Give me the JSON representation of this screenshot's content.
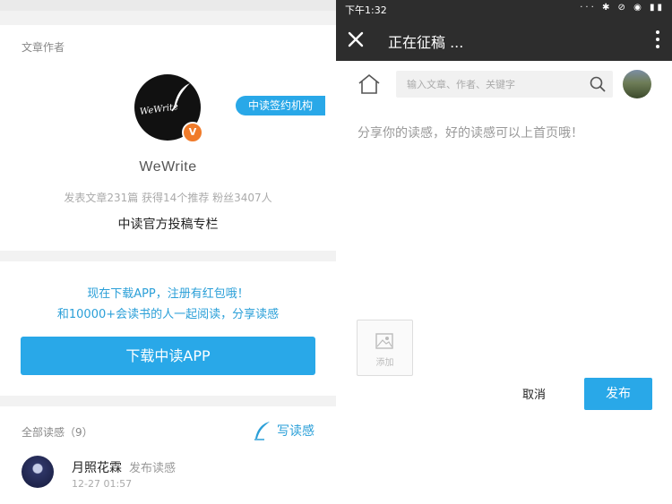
{
  "left": {
    "author": {
      "section_label": "文章作者",
      "avatar_text": "WeWrite",
      "badge": "V",
      "tag": "中读签约机构",
      "name": "WeWrite",
      "stats": "发表文章231篇 获得14个推荐 粉丝3407人",
      "column": "中读官方投稿专栏"
    },
    "promo": {
      "line1": "现在下载APP，注册有红包哦！",
      "line2": "和10000+会读书的人一起阅读，分享读感",
      "download_button": "下载中读APP"
    },
    "reviews": {
      "label": "全部读感（9）",
      "write_label": "写读感",
      "items": [
        {
          "user": "月照花霖",
          "action": "发布读感",
          "time": "12-27 01:57"
        }
      ]
    }
  },
  "right": {
    "status_bar": {
      "time": "下午1:32",
      "icons": "··· ✱ ⊘ ◉ ▮▮"
    },
    "app_bar": {
      "title": "正在征稿 ..."
    },
    "search": {
      "placeholder": "输入文章、作者、关键字"
    },
    "editor": {
      "placeholder": "分享你的读感，好的读感可以上首页哦！"
    },
    "add_image": {
      "label": "添加"
    },
    "actions": {
      "cancel": "取消",
      "publish": "发布"
    }
  },
  "icons": [
    "close-icon",
    "more-icon",
    "home-icon",
    "search-icon",
    "image-icon",
    "feather-icon"
  ],
  "colors": {
    "accent": "#29a8e8",
    "app_bar": "#2d2d2d",
    "badge": "#f07b2a"
  }
}
